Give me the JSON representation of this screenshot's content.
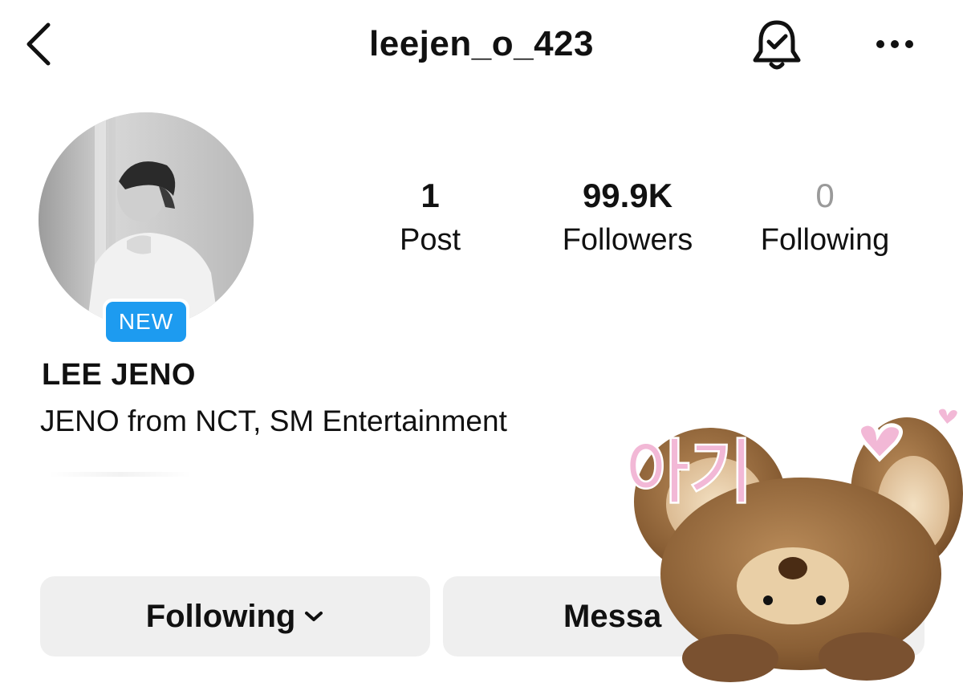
{
  "header": {
    "username": "leejen_o_423"
  },
  "profile": {
    "badge": "NEW",
    "display_name": "LEE JENO",
    "bio": "JENO from NCT, SM Entertainment"
  },
  "stats": [
    {
      "value": "1",
      "label": "Post"
    },
    {
      "value": "99.9K",
      "label": "Followers"
    },
    {
      "value": "0",
      "label": "Following"
    }
  ],
  "actions": {
    "following_label": "Following",
    "message_label": "Messa"
  },
  "sticker": {
    "text": "아기"
  },
  "icons": {
    "back": "chevron-left-icon",
    "bell": "bell-check-icon",
    "more": "more-horizontal-icon",
    "dropdown": "chevron-down-icon"
  },
  "colors": {
    "badge_blue": "#1d9bf0",
    "button_gray": "#efefef",
    "muted_text": "#9a9a9a",
    "sticker_pink": "#f2b8d6"
  }
}
